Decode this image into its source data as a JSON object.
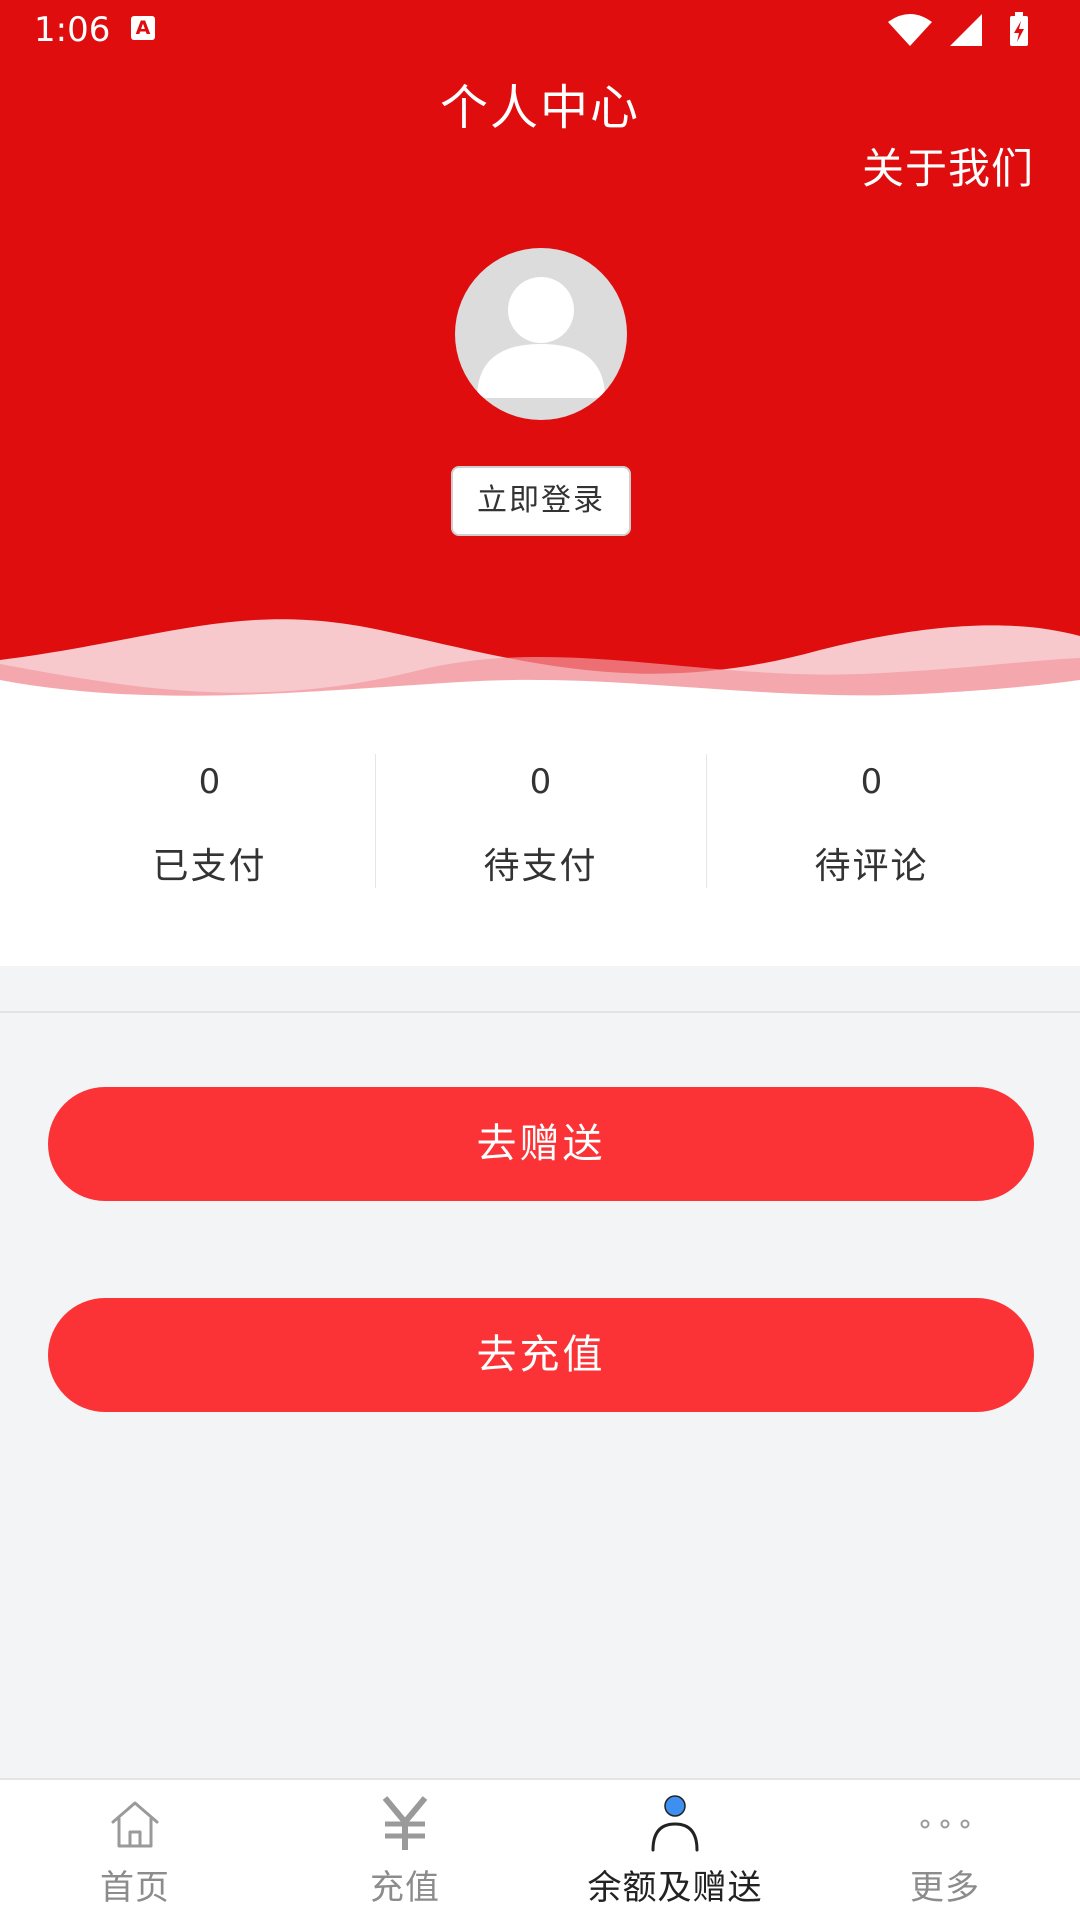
{
  "status_bar": {
    "time": "1:06",
    "notification_letter": "A"
  },
  "header": {
    "title": "个人中心",
    "about_label": "关于我们",
    "login_label": "立即登录"
  },
  "stats": [
    {
      "count": "0",
      "label": "已支付"
    },
    {
      "count": "0",
      "label": "待支付"
    },
    {
      "count": "0",
      "label": "待评论"
    }
  ],
  "actions": {
    "gift_label": "去赠送",
    "recharge_label": "去充值"
  },
  "tabs": [
    {
      "label": "首页",
      "icon": "home-icon",
      "active": false
    },
    {
      "label": "充值",
      "icon": "yen-icon",
      "active": false
    },
    {
      "label": "余额及赠送",
      "icon": "person-icon",
      "active": true
    },
    {
      "label": "更多",
      "icon": "more-dots-icon",
      "active": false
    }
  ],
  "colors": {
    "header_red": "#df0d0e",
    "button_red": "#fb3336",
    "active_dot": "#3d8ff0",
    "page_bg": "#f3f4f6"
  }
}
